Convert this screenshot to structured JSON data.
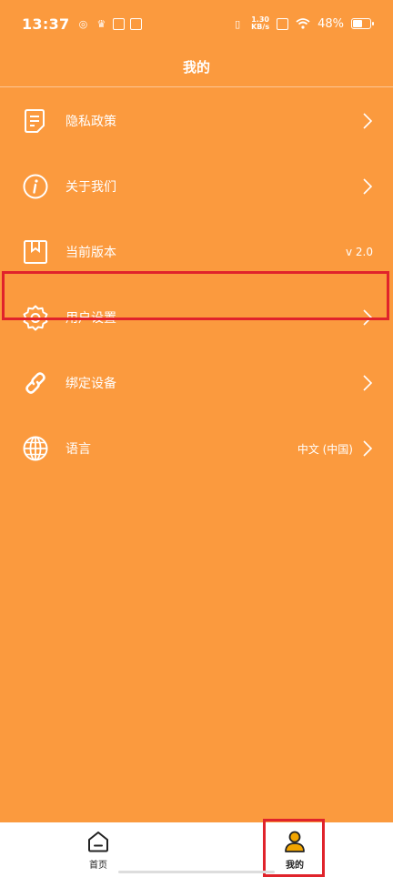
{
  "status_bar": {
    "time": "13:37",
    "speed_top": "1.30",
    "speed_bottom": "KB/s",
    "battery": "48%",
    "battery_level": 0.48
  },
  "header": {
    "title": "我的"
  },
  "menu": {
    "items": [
      {
        "label": "隐私政策",
        "icon": "document-icon",
        "value": "",
        "has_chevron": true
      },
      {
        "label": "关于我们",
        "icon": "info-icon",
        "value": "",
        "has_chevron": true
      },
      {
        "label": "当前版本",
        "icon": "bookmark-icon",
        "value": "v 2.0",
        "has_chevron": false
      },
      {
        "label": "用户设置",
        "icon": "gear-icon",
        "value": "",
        "has_chevron": true
      },
      {
        "label": "绑定设备",
        "icon": "link-icon",
        "value": "",
        "has_chevron": true
      },
      {
        "label": "语言",
        "icon": "globe-icon",
        "value": "中文 (中国)",
        "has_chevron": true
      }
    ]
  },
  "bottom_nav": {
    "items": [
      {
        "label": "首页",
        "icon": "home-icon",
        "active": false
      },
      {
        "label": "我的",
        "icon": "user-icon",
        "active": true
      }
    ]
  },
  "colors": {
    "background": "#FB9A3E",
    "highlight_border": "#E0232B",
    "active_tab": "#F2A500"
  }
}
